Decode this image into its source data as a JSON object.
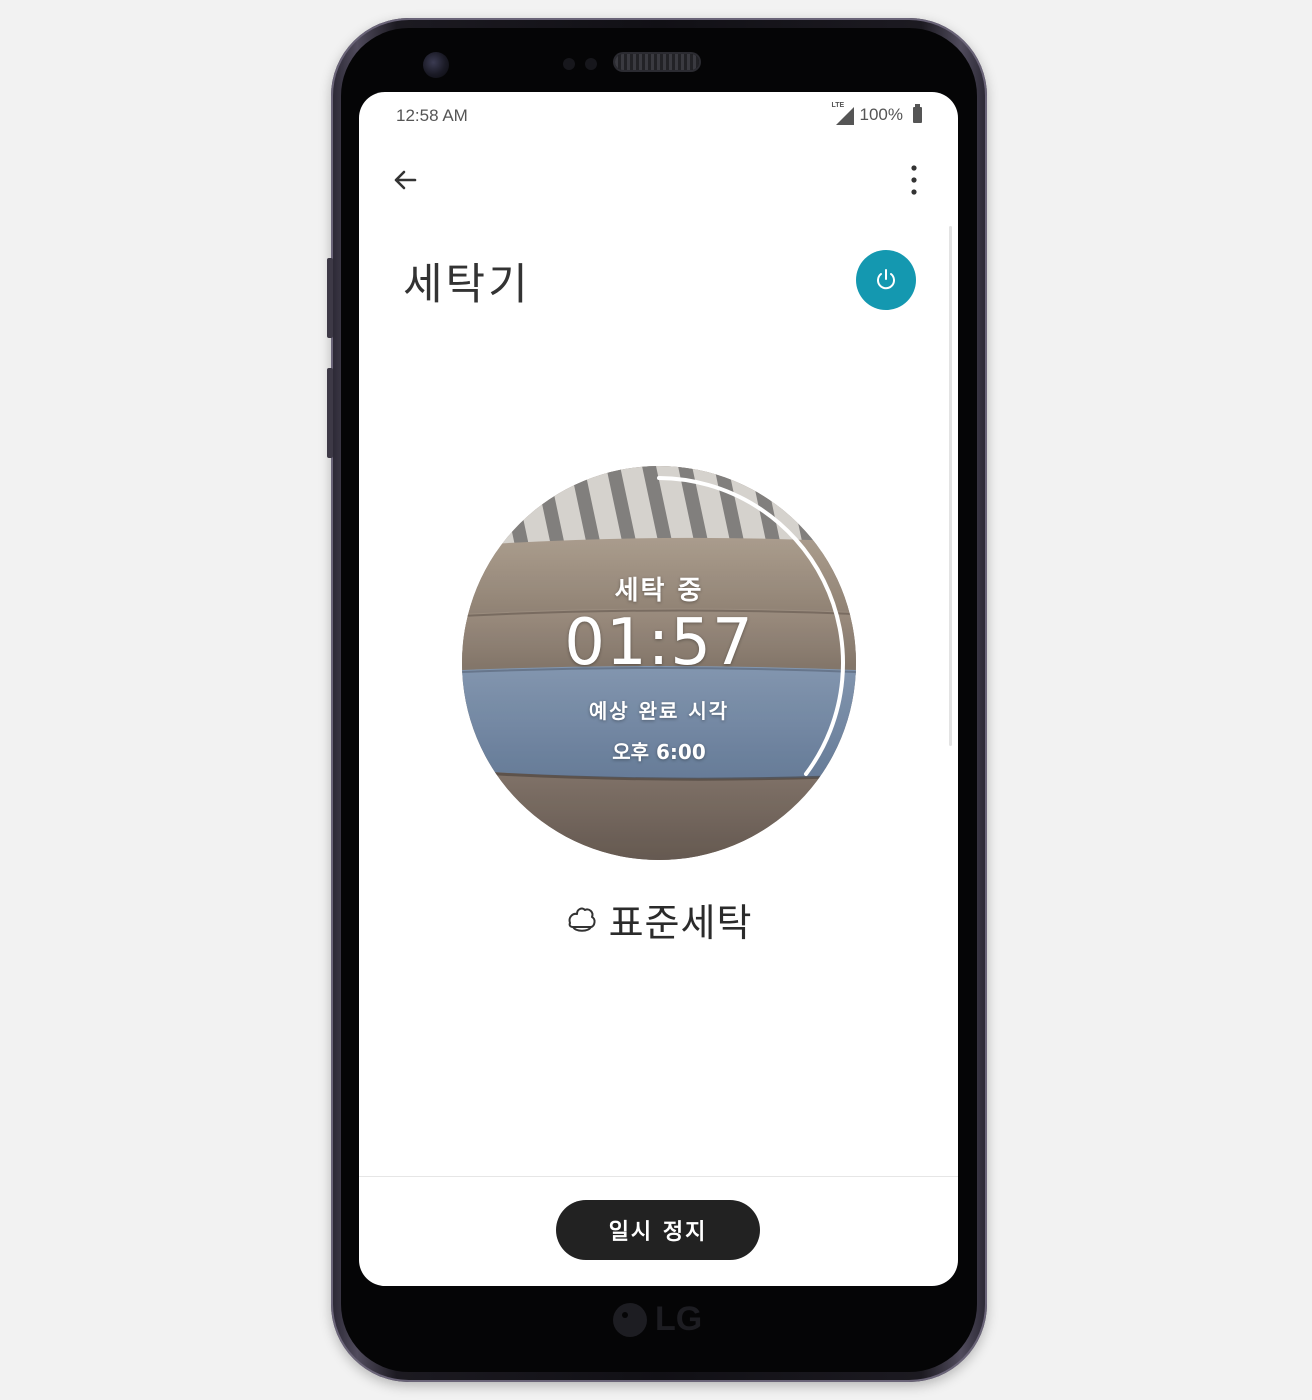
{
  "status_bar": {
    "time": "12:58 AM",
    "network": "LTE",
    "battery": "100%"
  },
  "app_bar": {
    "back_icon": "arrow-left-icon",
    "more_icon": "more-vert-icon"
  },
  "device": {
    "title": "세탁기",
    "power_icon": "power-icon",
    "accent_color": "#1498b0"
  },
  "status": {
    "state": "세탁 중",
    "remaining": "01:57",
    "eta_label": "예상 완료 시각",
    "eta_time": "오후 6:00"
  },
  "course": {
    "icon": "cotton-icon",
    "name": "표준세탁"
  },
  "actions": {
    "pause_label": "일시 정지"
  },
  "hardware": {
    "brand": "LG"
  }
}
